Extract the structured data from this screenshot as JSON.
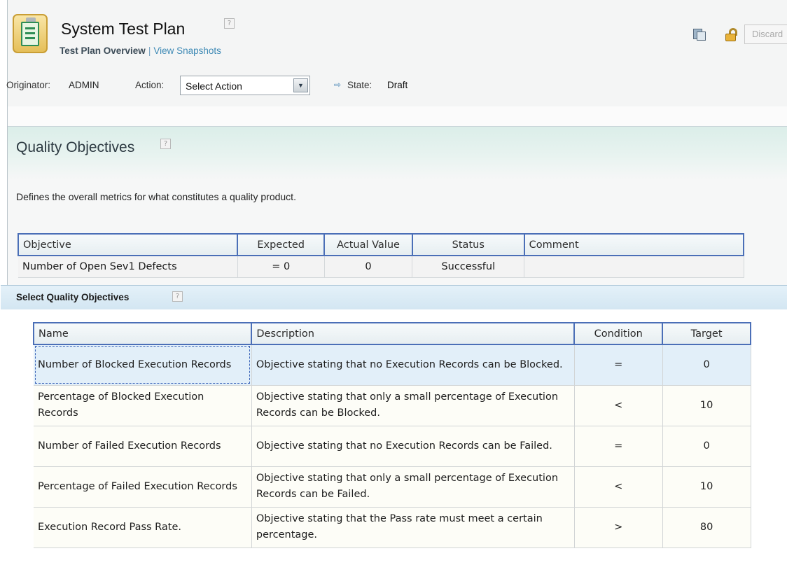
{
  "header": {
    "title": "System Test Plan",
    "help": "?",
    "subnav_current": "Test Plan Overview",
    "subnav_separator": "|",
    "subnav_link": "View Snapshots",
    "discard_label": "Discard"
  },
  "meta": {
    "originator_label": "Originator:",
    "originator_value": "ADMIN",
    "action_label": "Action:",
    "action_select_value": "Select Action",
    "state_label": "State:",
    "state_value": "Draft"
  },
  "quality_objectives": {
    "title": "Quality Objectives",
    "description": "Defines the overall metrics for what constitutes a quality product.",
    "columns": [
      "Objective",
      "Expected",
      "Actual Value",
      "Status",
      "Comment"
    ],
    "rows": [
      {
        "objective": "Number of Open Sev1 Defects",
        "expected": "= 0",
        "actual": "0",
        "status": "Successful",
        "comment": ""
      }
    ]
  },
  "dialog": {
    "title": "Select Quality Objectives",
    "columns": [
      "Name",
      "Description",
      "Condition",
      "Target"
    ],
    "rows": [
      {
        "name": "Number of Blocked Execution Records",
        "description": "Objective stating that no Execution Records can be Blocked.",
        "condition": "=",
        "target": "0"
      },
      {
        "name": "Percentage of Blocked Execution Records",
        "description": "Objective stating that only a small percentage of Execution Records can be Blocked.",
        "condition": "<",
        "target": "10"
      },
      {
        "name": "Number of Failed Execution Records",
        "description": "Objective stating that no Execution Records can be Failed.",
        "condition": "=",
        "target": "0"
      },
      {
        "name": "Percentage of Failed Execution Records",
        "description": "Objective stating that only a small percentage of Execution Records can be Failed.",
        "condition": "<",
        "target": "10"
      },
      {
        "name": "Execution Record Pass Rate.",
        "description": "Objective stating that the Pass rate must meet a certain percentage.",
        "condition": ">",
        "target": "80"
      }
    ],
    "selected_row": 0
  },
  "icons": {
    "plan": "test-plan-icon",
    "report": "report-icon",
    "lock": "unlock-icon",
    "state_arrow": "arrow-right-icon",
    "select_arrow": "chevron-down-icon"
  },
  "colors": {
    "link": "#3d89b5",
    "table_header_border": "#4b6fb7",
    "section_header": "#dbeee9",
    "dialog_header": "#d3e6f2",
    "selected_row": "#e2eff9"
  }
}
